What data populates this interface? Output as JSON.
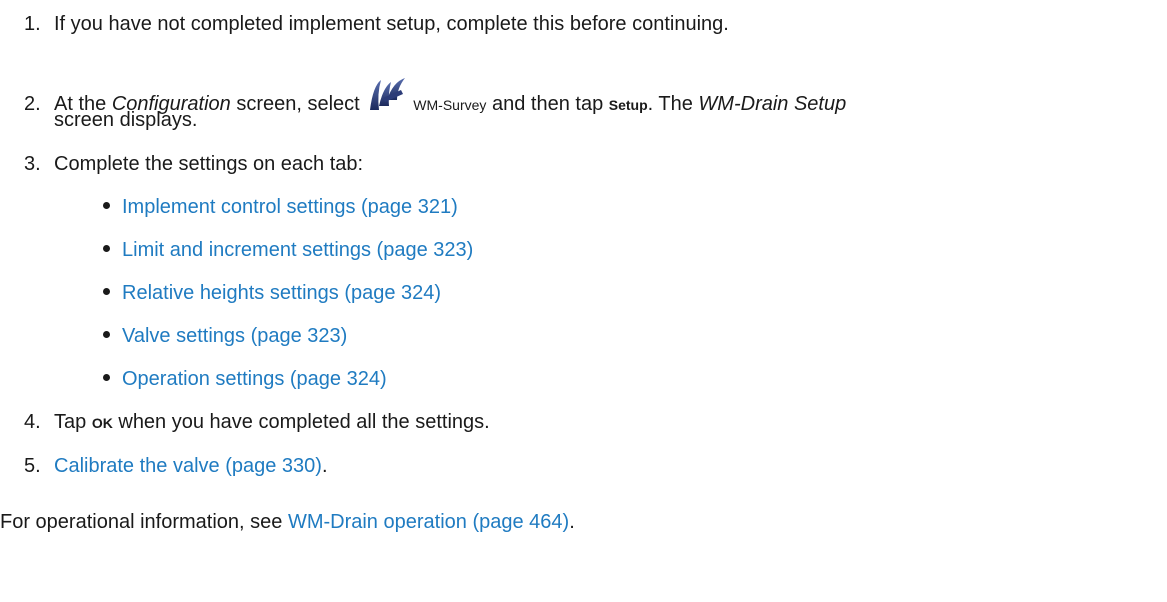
{
  "steps": [
    {
      "number": "1.",
      "text": "If you have not completed implement setup, complete this before continuing."
    },
    {
      "number": "2.",
      "pre": "At the ",
      "screen_name": "Configuration",
      "mid": " screen, select ",
      "icon": "wm-survey-app-icon",
      "app_label": "WM-Survey",
      "and_tap": " and then tap ",
      "button_label": "Setup",
      "after": ". The ",
      "result_screen": "WM-Drain Setup",
      "line2": "screen displays."
    },
    {
      "number": "3.",
      "text": "Complete the settings on each tab:",
      "links": [
        "Implement control settings (page 321)",
        "Limit and increment settings (page 323)",
        "Relative heights settings (page 324)",
        "Valve settings (page 323)",
        "Operation settings (page 324)"
      ]
    },
    {
      "number": "4.",
      "pre": "Tap ",
      "button_label": "OK",
      "post": " when you have completed all the settings."
    },
    {
      "number": "5.",
      "link": "Calibrate the valve (page 330)",
      "post": "."
    }
  ],
  "footer": {
    "pre": "For operational information, see ",
    "link": "WM-Drain operation (page 464)",
    "post": "."
  },
  "colors": {
    "link": "#1f7bc1",
    "text": "#1a1a1a"
  }
}
